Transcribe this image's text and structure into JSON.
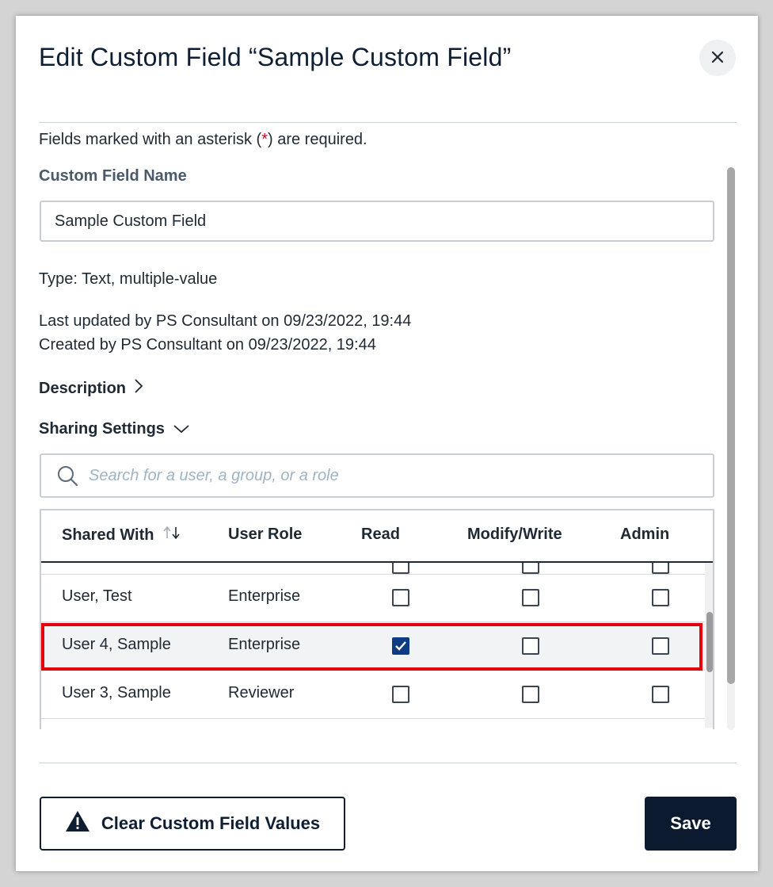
{
  "dialog": {
    "title": "Edit Custom Field “Sample Custom Field”",
    "close_icon": "close-icon"
  },
  "required_note": {
    "prefix": "Fields marked with an asterisk (",
    "asterisk": "*",
    "suffix": ") are required."
  },
  "custom_field_name": {
    "label": "Custom Field Name",
    "value": "Sample Custom Field"
  },
  "info": {
    "type": "Type: Text, multiple-value",
    "last_updated": "Last updated by PS Consultant on 09/23/2022, 19:44",
    "created": "Created by PS Consultant on 09/23/2022, 19:44"
  },
  "description": {
    "label": "Description",
    "icon": "chevron-right-icon",
    "expanded": false
  },
  "sharing_settings": {
    "label": "Sharing Settings",
    "icon": "chevron-down-icon",
    "expanded": true,
    "search_placeholder": "Search for a user, a group, or a role",
    "columns": [
      "Shared With",
      "User Role",
      "Read",
      "Modify/Write",
      "Admin"
    ],
    "sort_icon": "sort-icon",
    "rows": [
      {
        "name": "User, Test",
        "role": "Enterprise",
        "read": false,
        "modify": false,
        "admin": false
      },
      {
        "name": "User 4, Sample",
        "role": "Enterprise",
        "read": true,
        "modify": false,
        "admin": false,
        "highlighted": true
      },
      {
        "name": "User 3, Sample",
        "role": "Reviewer",
        "read": false,
        "modify": false,
        "admin": false
      }
    ]
  },
  "footer": {
    "clear_label": "Clear Custom Field Values",
    "clear_icon": "warning-icon",
    "save_label": "Save"
  },
  "colors": {
    "primary": "#0b1a2e",
    "checked": "#0f3b82",
    "highlight_border": "#e3000f",
    "required": "#d0021b"
  }
}
